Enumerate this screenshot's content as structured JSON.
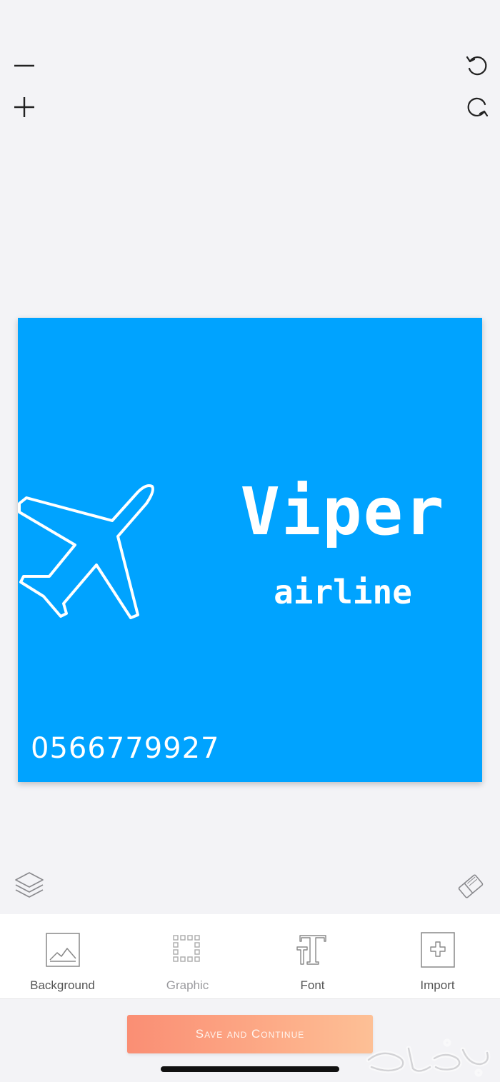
{
  "top_controls": {
    "zoom_out_icon": "minus-icon",
    "zoom_in_icon": "plus-icon",
    "undo_icon": "undo-icon",
    "redo_icon": "redo-icon"
  },
  "canvas": {
    "background_color": "#00a3ff",
    "title": "Viper",
    "subtitle": "airline",
    "phone": "0566779927",
    "graphic_icon": "airplane-icon"
  },
  "side_controls": {
    "layers_icon": "layers-icon",
    "eraser_icon": "eraser-icon"
  },
  "toolbar": {
    "items": [
      {
        "label": "Background",
        "icon": "image-icon"
      },
      {
        "label": "Graphic",
        "icon": "dotted-square-icon"
      },
      {
        "label": "Font",
        "icon": "text-icon"
      },
      {
        "label": "Import",
        "icon": "add-image-icon"
      }
    ]
  },
  "actions": {
    "save_label": "Save and Continue",
    "accent_color": "#fa8e74"
  }
}
